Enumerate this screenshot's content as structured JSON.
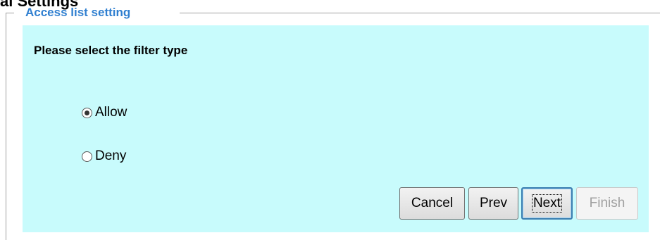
{
  "page": {
    "heading": "al Settings"
  },
  "fieldset": {
    "legend": "Access list setting"
  },
  "form": {
    "prompt": "Please select the filter type",
    "options": [
      {
        "label": "Allow",
        "selected": true
      },
      {
        "label": "Deny",
        "selected": false
      }
    ]
  },
  "buttons": {
    "cancel": "Cancel",
    "prev": "Prev",
    "next": "Next",
    "finish": "Finish"
  },
  "colors": {
    "legend_text": "#2f7fd0",
    "panel_background": "#c8fbfc",
    "focus_border": "#3c7fb1"
  }
}
